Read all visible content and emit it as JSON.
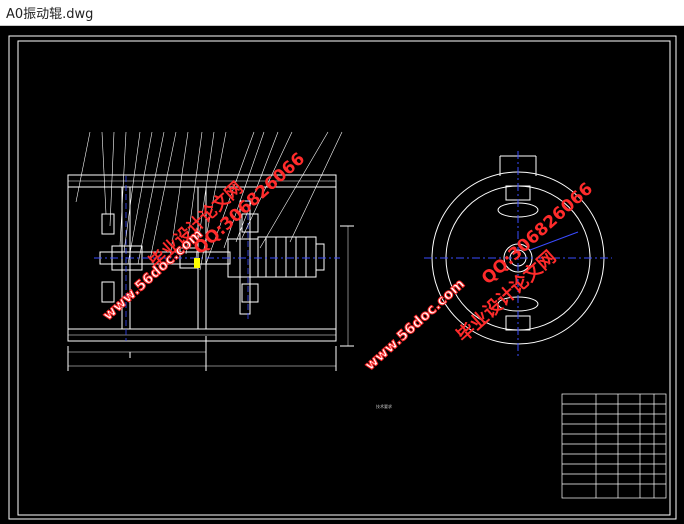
{
  "window": {
    "title": "A0振动辊.dwg"
  },
  "colors": {
    "canvas_bg": "#000000",
    "line": "#ffffff",
    "centerline": "#3a4bff",
    "accent": "#ff2b2b",
    "highlight": "#ffff00"
  },
  "watermarks": {
    "site_left": "www.56doc.com",
    "site_right": "www.56doc.com",
    "qq_left": "QQ:306826066",
    "qq_right": "QQ:306826066",
    "brand_left": "毕业设计论文网",
    "brand_right": "毕业设计论文网"
  },
  "notes": {
    "title": "技术要求"
  }
}
